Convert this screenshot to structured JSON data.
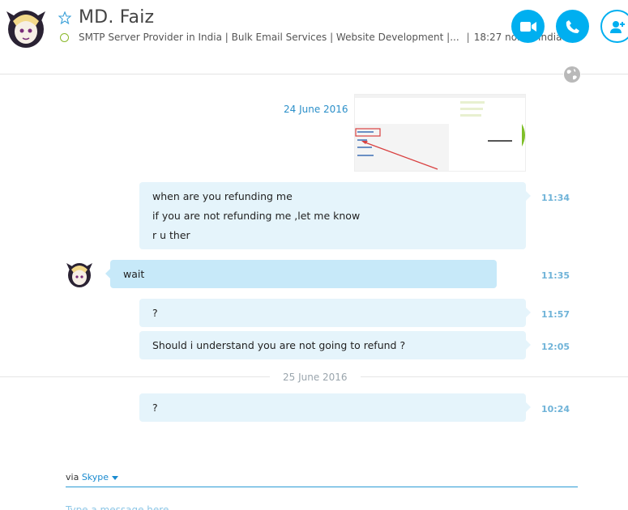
{
  "contact": {
    "name": "MD. Faiz",
    "mood": "SMTP Server Provider in India | Bulk Email Services | Website Development |...",
    "local_time": "18:27",
    "location": "noida, India"
  },
  "header_actions": {
    "video_icon": "video-camera-icon",
    "call_icon": "phone-icon",
    "add_icon": "add-person-icon"
  },
  "colors": {
    "accent": "#00aff0",
    "bubble_out": "#e5f4fb",
    "bubble_in": "#c7e9f9",
    "presence": "#8ab82a"
  },
  "dates": [
    "24 June 2016",
    "25 June 2016"
  ],
  "messages": [
    {
      "lines": [
        "when are you refunding me",
        "if you are not refunding me ,let me know",
        "r u ther"
      ],
      "time": "11:34"
    },
    {
      "lines": [
        "wait"
      ],
      "time": "11:35"
    },
    {
      "lines": [
        "?"
      ],
      "time": "11:57"
    },
    {
      "lines": [
        "Should i understand you are not going to refund ?"
      ],
      "time": "12:05"
    },
    {
      "lines": [
        "?"
      ],
      "time": "10:24"
    }
  ],
  "footer": {
    "via": "via",
    "service": "Skype",
    "placeholder": "Type a message here"
  }
}
